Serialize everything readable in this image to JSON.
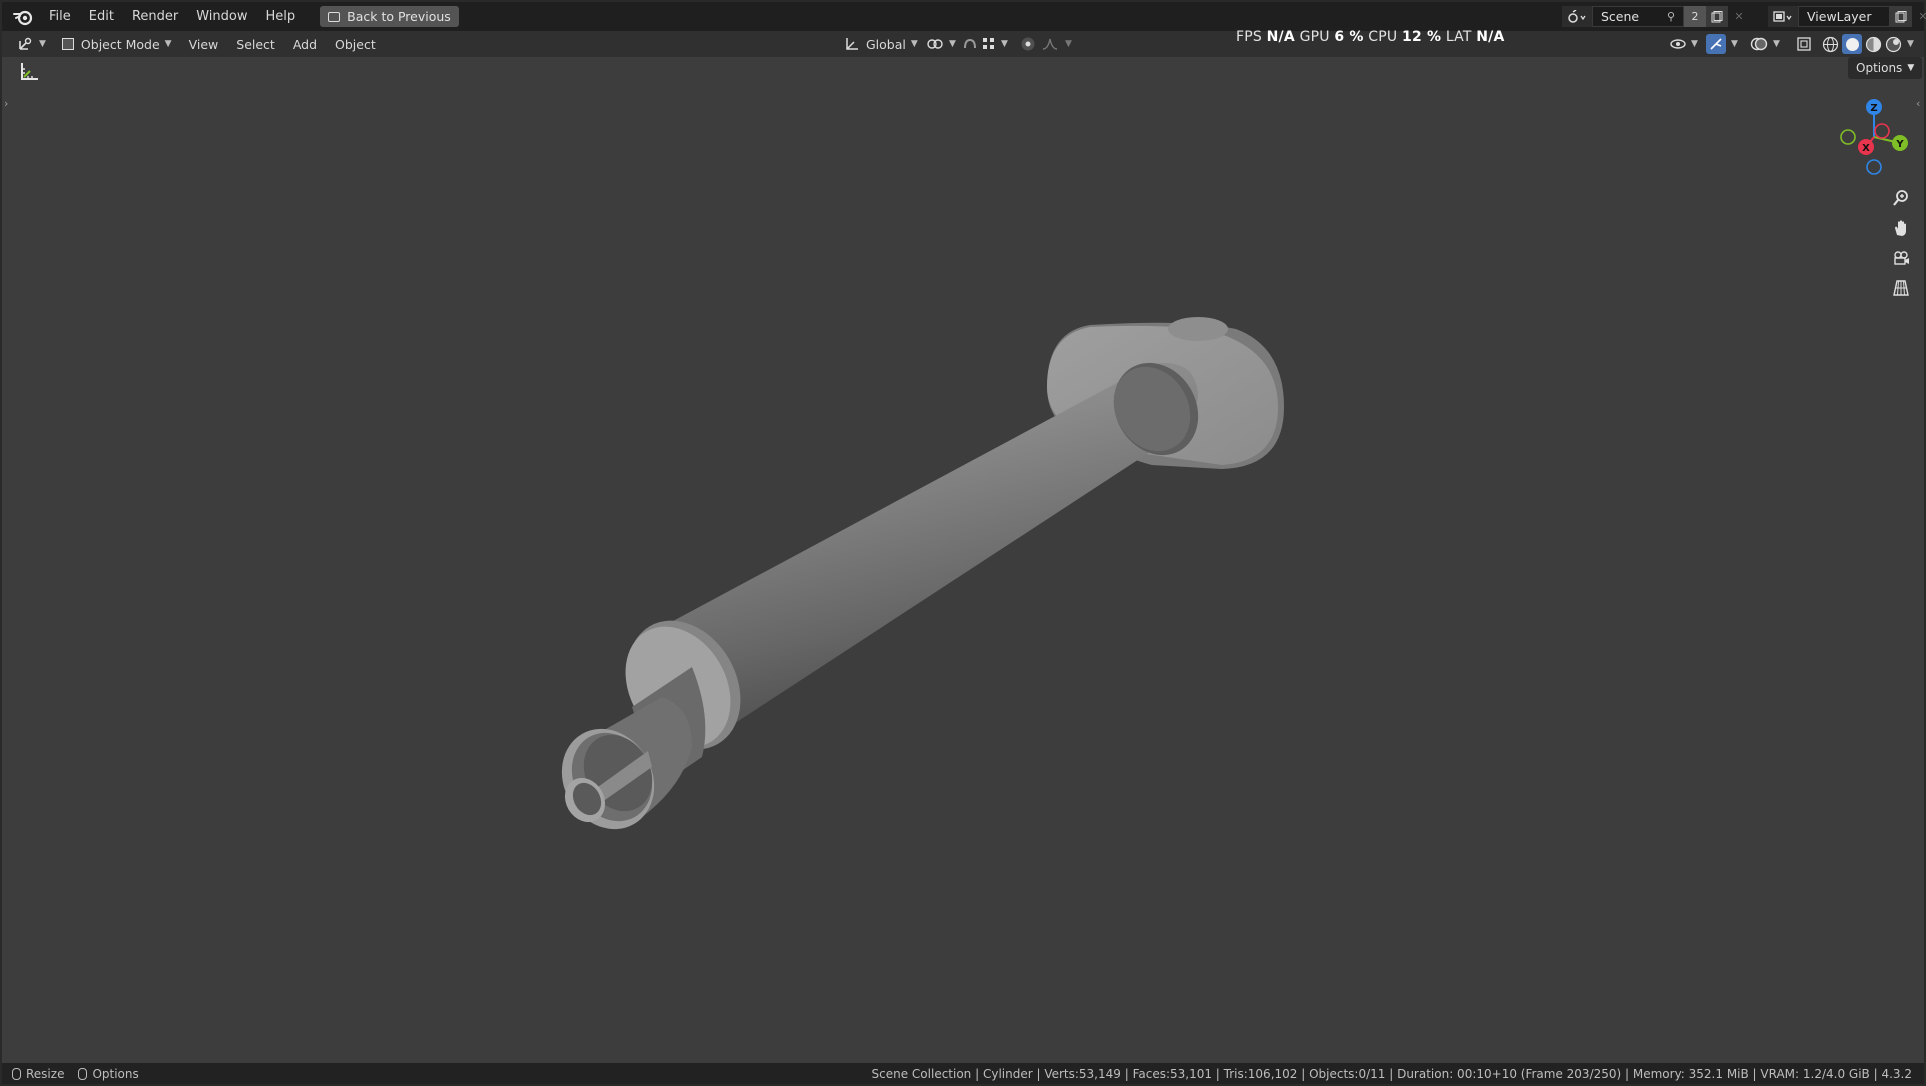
{
  "menu": {
    "items": [
      "File",
      "Edit",
      "Render",
      "Window",
      "Help"
    ],
    "back_button": "Back to Previous"
  },
  "scene": {
    "name": "Scene",
    "user_count": "2",
    "view_layer": "ViewLayer"
  },
  "viewport_header": {
    "mode": "Object Mode",
    "menus": [
      "View",
      "Select",
      "Add",
      "Object"
    ],
    "orientation": "Global"
  },
  "stats": {
    "fps_label": "FPS",
    "fps_value": "N/A",
    "gpu_label": "GPU",
    "gpu_value": "6 %",
    "cpu_label": "CPU",
    "cpu_value": "12 %",
    "lat_label": "LAT",
    "lat_value": "N/A"
  },
  "viewport": {
    "options_label": "Options",
    "gizmo_axes": [
      "Z",
      "X",
      "Y"
    ]
  },
  "statusbar": {
    "resize_label": "Resize",
    "options_label": "Options",
    "info": "Scene Collection | Cylinder | Verts:53,149 | Faces:53,101 | Tris:106,102 | Objects:0/11 | Duration: 00:10+10 (Frame 203/250) | Memory: 352.1 MiB | VRAM: 1.2/4.0 GiB | 4.3.2"
  },
  "colors": {
    "background": "#3d3d3d",
    "axis_x": "#e8344d",
    "axis_y": "#7fbe26",
    "axis_z": "#2f86e6",
    "accent": "#4772b3"
  },
  "icons": [
    "blender-logo-icon",
    "editor-type-icon",
    "object-mode-icon",
    "transform-orientation-icon",
    "pivot-icon",
    "snap-icon",
    "proportional-edit-icon",
    "visibility-icon",
    "gizmo-icon",
    "overlay-icon",
    "xray-icon",
    "shading-wireframe-icon",
    "shading-solid-icon",
    "shading-material-icon",
    "shading-rendered-icon",
    "zoom-icon",
    "hand-pan-icon",
    "camera-icon",
    "grid-perspective-icon",
    "measure-tool-icon"
  ]
}
